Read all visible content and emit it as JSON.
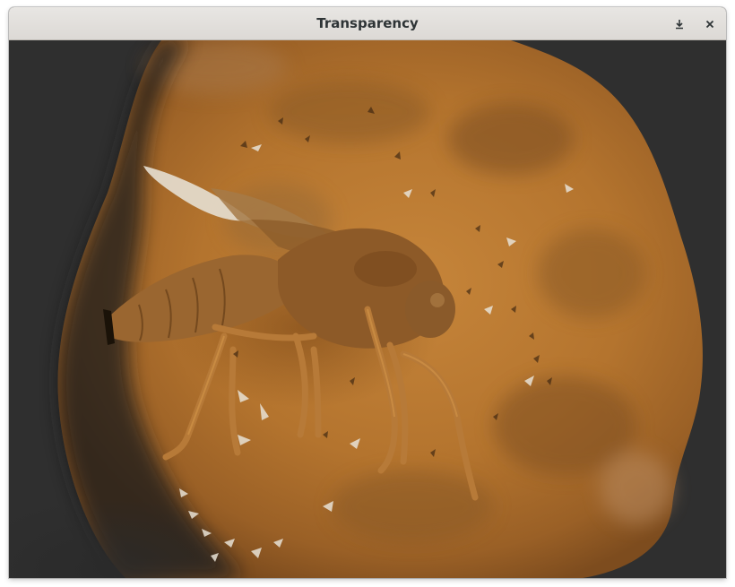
{
  "window": {
    "title": "Transparency",
    "buttons": {
      "minimize_icon": "minimize-icon",
      "close_icon": "close-icon"
    }
  },
  "scene": {
    "description_colors": {
      "background": "#2f2f2f",
      "amber": "#b8772e",
      "amber_dark": "#6e4318",
      "insect": "#a0682c"
    }
  }
}
